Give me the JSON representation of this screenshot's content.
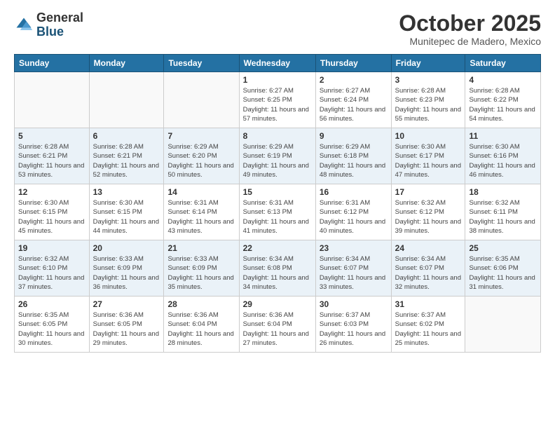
{
  "header": {
    "logo_general": "General",
    "logo_blue": "Blue",
    "month": "October 2025",
    "location": "Munitepec de Madero, Mexico"
  },
  "weekdays": [
    "Sunday",
    "Monday",
    "Tuesday",
    "Wednesday",
    "Thursday",
    "Friday",
    "Saturday"
  ],
  "weeks": [
    [
      {
        "day": "",
        "sunrise": "",
        "sunset": "",
        "daylight": ""
      },
      {
        "day": "",
        "sunrise": "",
        "sunset": "",
        "daylight": ""
      },
      {
        "day": "",
        "sunrise": "",
        "sunset": "",
        "daylight": ""
      },
      {
        "day": "1",
        "sunrise": "Sunrise: 6:27 AM",
        "sunset": "Sunset: 6:25 PM",
        "daylight": "Daylight: 11 hours and 57 minutes."
      },
      {
        "day": "2",
        "sunrise": "Sunrise: 6:27 AM",
        "sunset": "Sunset: 6:24 PM",
        "daylight": "Daylight: 11 hours and 56 minutes."
      },
      {
        "day": "3",
        "sunrise": "Sunrise: 6:28 AM",
        "sunset": "Sunset: 6:23 PM",
        "daylight": "Daylight: 11 hours and 55 minutes."
      },
      {
        "day": "4",
        "sunrise": "Sunrise: 6:28 AM",
        "sunset": "Sunset: 6:22 PM",
        "daylight": "Daylight: 11 hours and 54 minutes."
      }
    ],
    [
      {
        "day": "5",
        "sunrise": "Sunrise: 6:28 AM",
        "sunset": "Sunset: 6:21 PM",
        "daylight": "Daylight: 11 hours and 53 minutes."
      },
      {
        "day": "6",
        "sunrise": "Sunrise: 6:28 AM",
        "sunset": "Sunset: 6:21 PM",
        "daylight": "Daylight: 11 hours and 52 minutes."
      },
      {
        "day": "7",
        "sunrise": "Sunrise: 6:29 AM",
        "sunset": "Sunset: 6:20 PM",
        "daylight": "Daylight: 11 hours and 50 minutes."
      },
      {
        "day": "8",
        "sunrise": "Sunrise: 6:29 AM",
        "sunset": "Sunset: 6:19 PM",
        "daylight": "Daylight: 11 hours and 49 minutes."
      },
      {
        "day": "9",
        "sunrise": "Sunrise: 6:29 AM",
        "sunset": "Sunset: 6:18 PM",
        "daylight": "Daylight: 11 hours and 48 minutes."
      },
      {
        "day": "10",
        "sunrise": "Sunrise: 6:30 AM",
        "sunset": "Sunset: 6:17 PM",
        "daylight": "Daylight: 11 hours and 47 minutes."
      },
      {
        "day": "11",
        "sunrise": "Sunrise: 6:30 AM",
        "sunset": "Sunset: 6:16 PM",
        "daylight": "Daylight: 11 hours and 46 minutes."
      }
    ],
    [
      {
        "day": "12",
        "sunrise": "Sunrise: 6:30 AM",
        "sunset": "Sunset: 6:15 PM",
        "daylight": "Daylight: 11 hours and 45 minutes."
      },
      {
        "day": "13",
        "sunrise": "Sunrise: 6:30 AM",
        "sunset": "Sunset: 6:15 PM",
        "daylight": "Daylight: 11 hours and 44 minutes."
      },
      {
        "day": "14",
        "sunrise": "Sunrise: 6:31 AM",
        "sunset": "Sunset: 6:14 PM",
        "daylight": "Daylight: 11 hours and 43 minutes."
      },
      {
        "day": "15",
        "sunrise": "Sunrise: 6:31 AM",
        "sunset": "Sunset: 6:13 PM",
        "daylight": "Daylight: 11 hours and 41 minutes."
      },
      {
        "day": "16",
        "sunrise": "Sunrise: 6:31 AM",
        "sunset": "Sunset: 6:12 PM",
        "daylight": "Daylight: 11 hours and 40 minutes."
      },
      {
        "day": "17",
        "sunrise": "Sunrise: 6:32 AM",
        "sunset": "Sunset: 6:12 PM",
        "daylight": "Daylight: 11 hours and 39 minutes."
      },
      {
        "day": "18",
        "sunrise": "Sunrise: 6:32 AM",
        "sunset": "Sunset: 6:11 PM",
        "daylight": "Daylight: 11 hours and 38 minutes."
      }
    ],
    [
      {
        "day": "19",
        "sunrise": "Sunrise: 6:32 AM",
        "sunset": "Sunset: 6:10 PM",
        "daylight": "Daylight: 11 hours and 37 minutes."
      },
      {
        "day": "20",
        "sunrise": "Sunrise: 6:33 AM",
        "sunset": "Sunset: 6:09 PM",
        "daylight": "Daylight: 11 hours and 36 minutes."
      },
      {
        "day": "21",
        "sunrise": "Sunrise: 6:33 AM",
        "sunset": "Sunset: 6:09 PM",
        "daylight": "Daylight: 11 hours and 35 minutes."
      },
      {
        "day": "22",
        "sunrise": "Sunrise: 6:34 AM",
        "sunset": "Sunset: 6:08 PM",
        "daylight": "Daylight: 11 hours and 34 minutes."
      },
      {
        "day": "23",
        "sunrise": "Sunrise: 6:34 AM",
        "sunset": "Sunset: 6:07 PM",
        "daylight": "Daylight: 11 hours and 33 minutes."
      },
      {
        "day": "24",
        "sunrise": "Sunrise: 6:34 AM",
        "sunset": "Sunset: 6:07 PM",
        "daylight": "Daylight: 11 hours and 32 minutes."
      },
      {
        "day": "25",
        "sunrise": "Sunrise: 6:35 AM",
        "sunset": "Sunset: 6:06 PM",
        "daylight": "Daylight: 11 hours and 31 minutes."
      }
    ],
    [
      {
        "day": "26",
        "sunrise": "Sunrise: 6:35 AM",
        "sunset": "Sunset: 6:05 PM",
        "daylight": "Daylight: 11 hours and 30 minutes."
      },
      {
        "day": "27",
        "sunrise": "Sunrise: 6:36 AM",
        "sunset": "Sunset: 6:05 PM",
        "daylight": "Daylight: 11 hours and 29 minutes."
      },
      {
        "day": "28",
        "sunrise": "Sunrise: 6:36 AM",
        "sunset": "Sunset: 6:04 PM",
        "daylight": "Daylight: 11 hours and 28 minutes."
      },
      {
        "day": "29",
        "sunrise": "Sunrise: 6:36 AM",
        "sunset": "Sunset: 6:04 PM",
        "daylight": "Daylight: 11 hours and 27 minutes."
      },
      {
        "day": "30",
        "sunrise": "Sunrise: 6:37 AM",
        "sunset": "Sunset: 6:03 PM",
        "daylight": "Daylight: 11 hours and 26 minutes."
      },
      {
        "day": "31",
        "sunrise": "Sunrise: 6:37 AM",
        "sunset": "Sunset: 6:02 PM",
        "daylight": "Daylight: 11 hours and 25 minutes."
      },
      {
        "day": "",
        "sunrise": "",
        "sunset": "",
        "daylight": ""
      }
    ]
  ]
}
